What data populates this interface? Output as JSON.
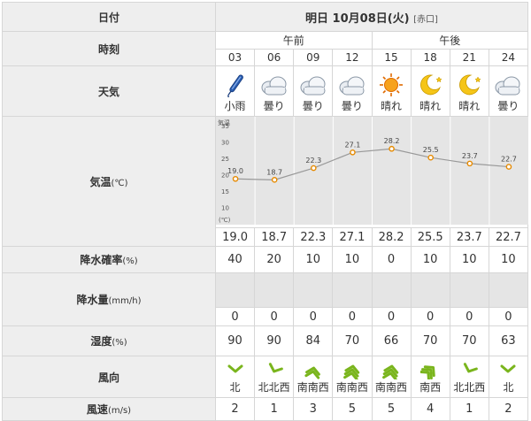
{
  "header": {
    "date_label": "日付",
    "date_text": "明日 10月08日(火)",
    "location": "[赤口]"
  },
  "labels": {
    "time": "時刻",
    "weather": "天気",
    "temp": "気温",
    "temp_unit": "(℃)",
    "precip_prob": "降水確率",
    "precip_prob_unit": "(%)",
    "precip_amount": "降水量",
    "precip_amount_unit": "(mm/h)",
    "humidity": "湿度",
    "humidity_unit": "(%)",
    "wind_dir": "風向",
    "wind_speed": "風速",
    "wind_speed_unit": "(m/s)"
  },
  "periods": {
    "am": "午前",
    "pm": "午後"
  },
  "hours": [
    "03",
    "06",
    "09",
    "12",
    "15",
    "18",
    "21",
    "24"
  ],
  "weather": [
    {
      "icon": "umbrella-icon",
      "label": "小雨"
    },
    {
      "icon": "cloud-icon",
      "label": "曇り"
    },
    {
      "icon": "cloud-icon",
      "label": "曇り"
    },
    {
      "icon": "cloud-icon",
      "label": "曇り"
    },
    {
      "icon": "sun-icon",
      "label": "晴れ"
    },
    {
      "icon": "moon-icon",
      "label": "晴れ"
    },
    {
      "icon": "moon-icon",
      "label": "晴れ"
    },
    {
      "icon": "cloud-icon",
      "label": "曇り"
    }
  ],
  "temp_chart": {
    "axis_title": "気温",
    "axis_unit": "(℃)",
    "ticks": [
      "35",
      "30",
      "25",
      "20",
      "15",
      "10"
    ],
    "ylim": [
      5,
      38
    ]
  },
  "temps": [
    "19.0",
    "18.7",
    "22.3",
    "27.1",
    "28.2",
    "25.5",
    "23.7",
    "22.7"
  ],
  "precip_prob": [
    "40",
    "20",
    "10",
    "10",
    "0",
    "10",
    "10",
    "10"
  ],
  "precip_amount": [
    "0",
    "0",
    "0",
    "0",
    "0",
    "0",
    "0",
    "0"
  ],
  "humidity": [
    "90",
    "90",
    "84",
    "70",
    "66",
    "70",
    "70",
    "63"
  ],
  "wind_dir": [
    "北",
    "北北西",
    "南南西",
    "南南西",
    "南南西",
    "南西",
    "北北西",
    "北"
  ],
  "wind_speed": [
    "2",
    "1",
    "3",
    "5",
    "5",
    "4",
    "1",
    "2"
  ],
  "colors": {
    "line": "#999999",
    "marker": "#e68a00",
    "grid": "#e5e5e5",
    "wind": "#7ab51d"
  }
}
